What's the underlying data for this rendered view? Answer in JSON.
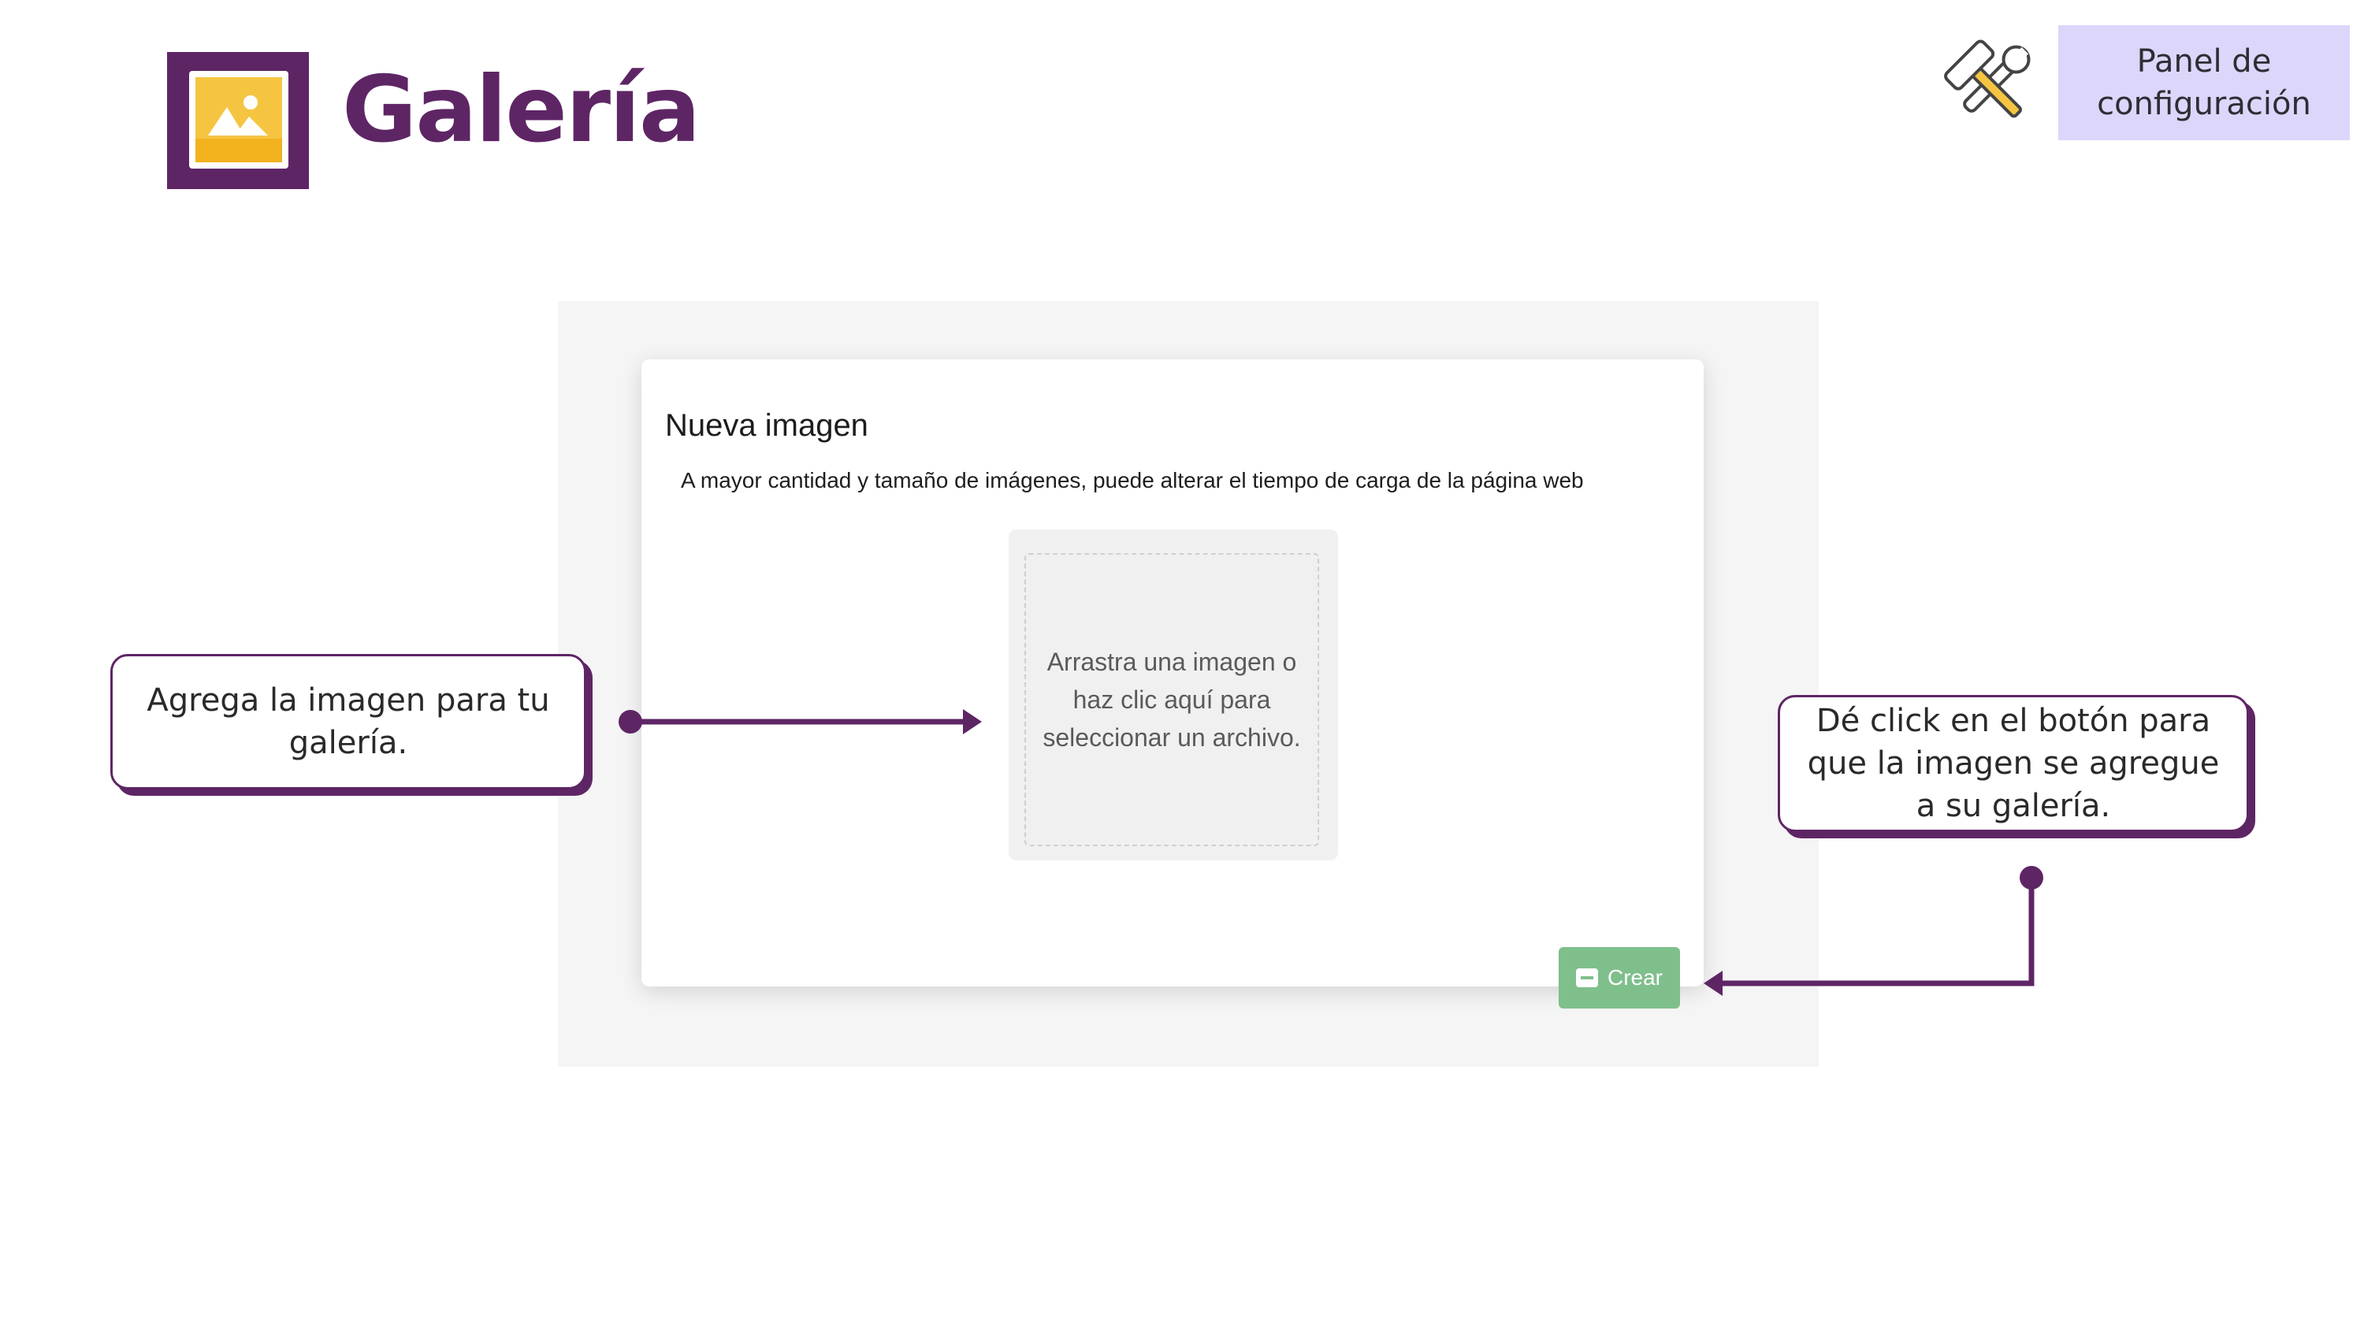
{
  "brand": {
    "title": "Galería"
  },
  "header": {
    "config_button_line1": "Panel de",
    "config_button_line2": "configuración"
  },
  "modal": {
    "title": "Nueva imagen",
    "notice": "A mayor cantidad y tamaño de imágenes, puede alterar el tiempo de carga de la página web",
    "dropzone_line1": "Arrastra una imagen o",
    "dropzone_line2": "haz clic aquí para",
    "dropzone_line3": "seleccionar un archivo.",
    "create_button": "Crear"
  },
  "callouts": {
    "left_line1": "Agrega la imagen para tu",
    "left_line2": "galería.",
    "right_line1": "Dé click en el botón para",
    "right_line2": "que la imagen se agregue",
    "right_line3": "a su galería."
  },
  "colors": {
    "brand_purple": "#5e2565",
    "config_bg": "#dcd6fb",
    "create_green": "#7fbf8c",
    "logo_yellow": "#f5b82e"
  },
  "icons": {
    "logo": "gallery-image-icon",
    "tools": "hammer-wrench-icon"
  }
}
